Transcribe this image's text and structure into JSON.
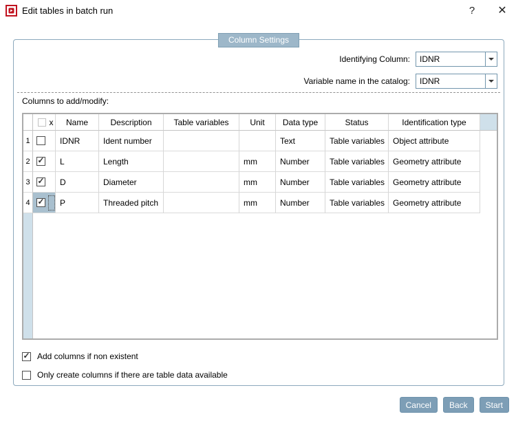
{
  "window": {
    "title": "Edit tables in batch run",
    "help_label": "?",
    "close_label": "✕"
  },
  "group": {
    "title": "Column Settings"
  },
  "fields": [
    {
      "label": "Identifying Column:",
      "value": "IDNR"
    },
    {
      "label": "Variable name in the catalog:",
      "value": "IDNR"
    }
  ],
  "table": {
    "caption": "Columns to add/modify:",
    "columns": [
      "x",
      "Name",
      "Description",
      "Table variables",
      "Unit",
      "Data type",
      "Status",
      "Identification type"
    ],
    "header_checkbox_checked": false,
    "rows": [
      {
        "num": "1",
        "checked": false,
        "selected": false,
        "name": "IDNR",
        "description": "Ident number",
        "table_variables": "",
        "unit": "",
        "data_type": "Text",
        "status": "Table variables",
        "identification_type": "Object attribute"
      },
      {
        "num": "2",
        "checked": true,
        "selected": false,
        "name": "L",
        "description": "Length",
        "table_variables": "",
        "unit": "mm",
        "data_type": "Number",
        "status": "Table variables",
        "identification_type": "Geometry attribute"
      },
      {
        "num": "3",
        "checked": true,
        "selected": false,
        "name": "D",
        "description": "Diameter",
        "table_variables": "",
        "unit": "mm",
        "data_type": "Number",
        "status": "Table variables",
        "identification_type": "Geometry attribute"
      },
      {
        "num": "4",
        "checked": true,
        "selected": true,
        "name": "P",
        "description": "Threaded pitch",
        "table_variables": "",
        "unit": "mm",
        "data_type": "Number",
        "status": "Table variables",
        "identification_type": "Geometry attribute"
      }
    ]
  },
  "options": [
    {
      "label": "Add columns if non existent",
      "checked": true
    },
    {
      "label": "Only create columns if there are table data available",
      "checked": false
    }
  ],
  "footer": {
    "buttons": [
      "Cancel",
      "Back",
      "Start"
    ]
  },
  "colors": {
    "accent": "#9db7c9",
    "frame": "#8ba8bc",
    "selection": "#a9c0cf",
    "light_blue": "#cfe0ea",
    "button": "#7d9eb6",
    "button_border": "#6d92ab",
    "icon_red": "#c0121f"
  }
}
